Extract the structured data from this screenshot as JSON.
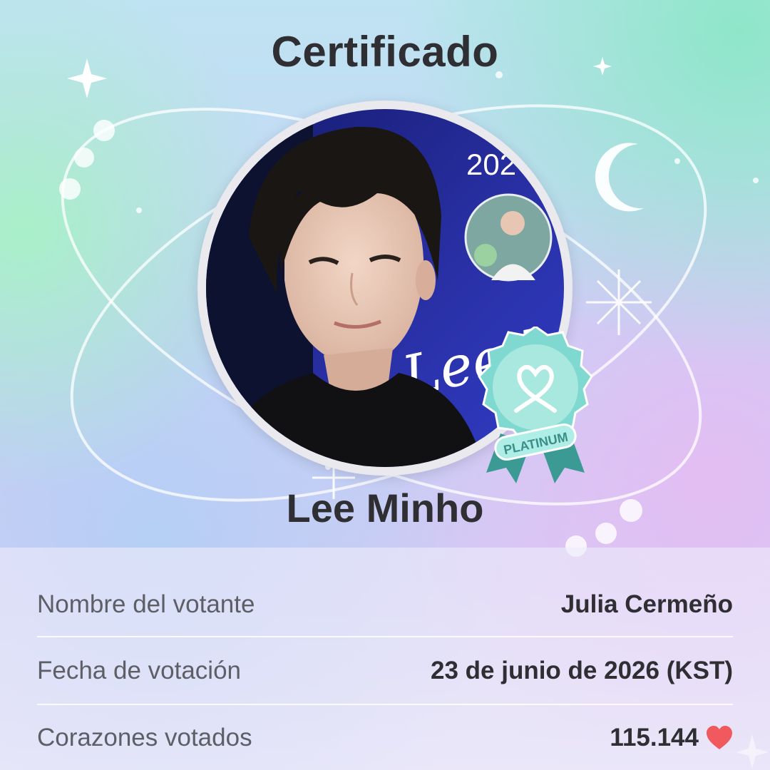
{
  "certificate": {
    "title": "Certificado",
    "artist_name": "Lee Minho",
    "photo": {
      "year_text": "202",
      "signature_text": "Lee Min"
    },
    "badge": {
      "tier": "PLATINUM",
      "colors": {
        "body": "#7fd9d0",
        "inner": "#a8e8df",
        "ribbon": "#3b9a93"
      }
    },
    "details": [
      {
        "label": "Nombre del votante",
        "value": "Julia Cermeño"
      },
      {
        "label": "Fecha de votación",
        "value": "23 de junio de 2026 (KST)"
      },
      {
        "label": "Corazones votados",
        "value": "115.144",
        "icon": "heart-icon"
      }
    ]
  },
  "colors": {
    "text": "#2e2e33",
    "label": "#5e5e66",
    "heart": "#f05a5e"
  }
}
